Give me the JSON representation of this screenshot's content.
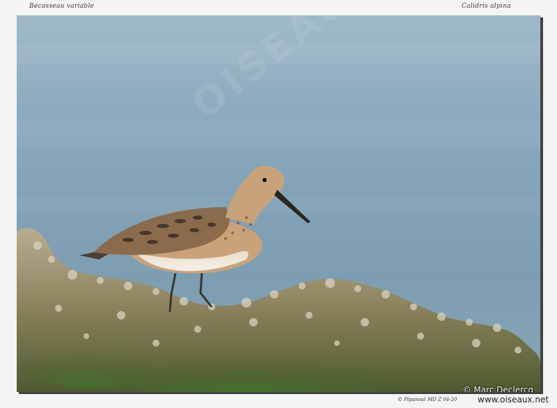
{
  "captions": {
    "common_name": "Bécasseau  variable",
    "latin_name": "Calidris  alpina"
  },
  "photo": {
    "subject": "bird",
    "watermark": "OISEAUX.NET",
    "copyright": "© Marc Declercq"
  },
  "footer": {
    "credits": "©  Pipanout MD    Z  04-20",
    "site": "www.oiseaux.net"
  }
}
